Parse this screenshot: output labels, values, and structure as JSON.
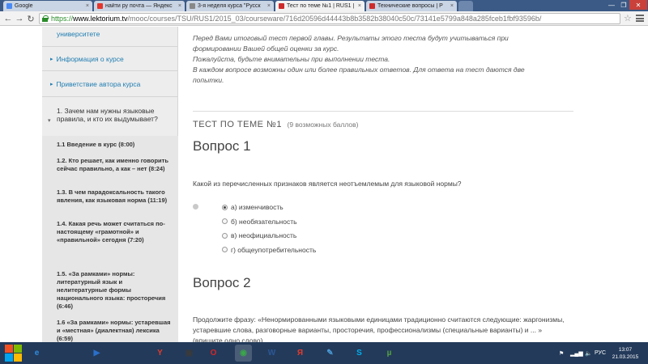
{
  "browser": {
    "tabs": [
      {
        "title": "Google",
        "color": "#4a8af4"
      },
      {
        "title": "найти ру почта — Яндекс",
        "color": "#e5362c"
      },
      {
        "title": "3-я неделя курса \"Русск",
        "color": "#888888"
      },
      {
        "title": "Тест по теме №1 | RUS1 |",
        "color": "#cc2b2b"
      },
      {
        "title": "Технические вопросы | Р",
        "color": "#cc2b2b"
      }
    ],
    "active_tab": 3,
    "url": {
      "scheme": "https://",
      "host": "www.lektorium.tv",
      "path": "/mooc/courses/TSU/RUS1/2015_03/courseware/716d20596d44443b8b3582b38040c50c/73141e5799a848a285fceb1fbf93596b/"
    }
  },
  "sidebar": {
    "top_partial": "университете",
    "links": [
      {
        "label": "Информация о курсе"
      },
      {
        "label": "Приветствие автора курса"
      }
    ],
    "chapter": "1. Зачем нам нужны языковые правила, и кто их выдумывает?",
    "lessons": [
      "1.1 Введение в курс (8:00)",
      "1.2. Кто решает, как именно говорить сейчас правильно, а как – нет (8:24)",
      "1.3. В чем парадоксальность такого явления, как языковая норма (11:19)",
      "1.4. Какая речь может считаться по-настоящему «грамотной» и «правильной» сегодня (7:20)",
      "1.5. «За рамками» нормы: литературный язык и нелитературные формы национального языка: просторечия (6:46)",
      "1.6 «За рамками» нормы: устаревшая и «местная» (диалектная) лексика (6:59)"
    ]
  },
  "content": {
    "intro": [
      "Перед Вами итоговый тест первой главы. Результаты этого теста будут учитываться при формировании Вашей общей оценки за курс.",
      "Пожалуйста, будьте внимательны при выполнении теста.",
      "В каждом вопросе возможны один или более правильных ответов. Для ответа на тест даются две попытки."
    ],
    "test_title": "ТЕСТ ПО ТЕМЕ №1",
    "test_points": "(9 возможных баллов)",
    "questions": [
      {
        "title": "Вопрос 1",
        "text": "Какой из перечисленных признаков является неотъемлемым для языковой нормы?",
        "options": [
          "а) изменчивость",
          "б) необязательность",
          "в) неофициальность",
          "г) общеупотребительность"
        ],
        "selected": 0
      },
      {
        "title": "Вопрос 2",
        "text": "Продолжите фразу: «Ненормированными языковыми единицами традиционно считаются следующие: жаргонизмы, устаревшие слова, разговорные варианты, просторечия, профессионализмы (специальные варианты) и ... » (впишите одно слово)"
      }
    ]
  },
  "taskbar": {
    "apps": [
      {
        "name": "internet-explorer-icon",
        "glyph": "e",
        "color": "#2f8ce0"
      },
      {
        "name": "file-explorer-icon",
        "glyph": "",
        "color": "#e8b845"
      },
      {
        "name": "media-player-icon",
        "glyph": "▶",
        "color": "#2a6fc9"
      },
      {
        "name": "yandex-browser-icon",
        "glyph": "Y",
        "color": "#e53a2a"
      },
      {
        "name": "video-app-icon",
        "glyph": "▣",
        "color": "#3a3a3a"
      },
      {
        "name": "opera-icon",
        "glyph": "O",
        "color": "#d62626"
      },
      {
        "name": "chrome-icon",
        "glyph": "◉",
        "color": "#3aa64a"
      },
      {
        "name": "word-icon",
        "glyph": "W",
        "color": "#2b5797"
      },
      {
        "name": "yandex-icon",
        "glyph": "Я",
        "color": "#e53a2a"
      },
      {
        "name": "paint-icon",
        "glyph": "✎",
        "color": "#4a9ad6"
      },
      {
        "name": "skype-icon",
        "glyph": "S",
        "color": "#00aff0"
      },
      {
        "name": "torrent-icon",
        "glyph": "µ",
        "color": "#54a340"
      }
    ],
    "lang": "РУС",
    "time": "13:07",
    "date": "21.03.2015"
  }
}
